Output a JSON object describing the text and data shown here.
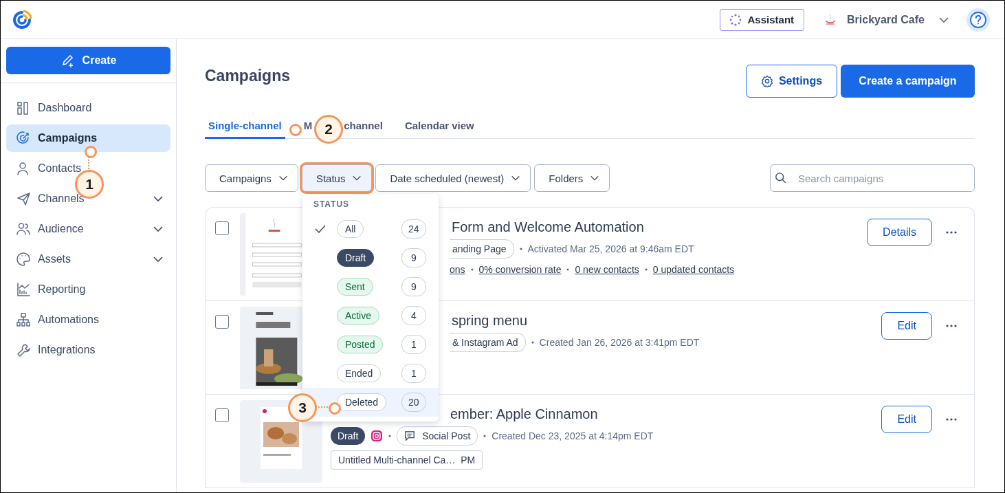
{
  "topbar": {
    "assistant": "Assistant",
    "account": "Brickyard Cafe"
  },
  "sidebar": {
    "create": "Create",
    "items": [
      {
        "label": "Dashboard",
        "selected": false,
        "expandable": false
      },
      {
        "label": "Campaigns",
        "selected": true,
        "expandable": false
      },
      {
        "label": "Contacts",
        "selected": false,
        "expandable": false
      },
      {
        "label": "Channels",
        "selected": false,
        "expandable": true
      },
      {
        "label": "Audience",
        "selected": false,
        "expandable": true
      },
      {
        "label": "Assets",
        "selected": false,
        "expandable": true
      },
      {
        "label": "Reporting",
        "selected": false,
        "expandable": false
      },
      {
        "label": "Automations",
        "selected": false,
        "expandable": false
      },
      {
        "label": "Integrations",
        "selected": false,
        "expandable": false
      }
    ]
  },
  "page": {
    "title": "Campaigns",
    "settings": "Settings",
    "create_campaign": "Create a campaign"
  },
  "tabs": [
    {
      "label": "Single-channel",
      "selected": true
    },
    {
      "label": "M",
      "label_end": "channel",
      "selected": false
    },
    {
      "label": "Calendar view",
      "selected": false
    }
  ],
  "filters": [
    {
      "label": "Campaigns",
      "open": false
    },
    {
      "label": "Status",
      "open": true
    },
    {
      "label": "Date scheduled (newest)",
      "open": false
    },
    {
      "label": "Folders",
      "open": false
    }
  ],
  "search": {
    "placeholder": "Search campaigns"
  },
  "status_menu": {
    "heading": "STATUS",
    "items": [
      {
        "label": "All",
        "count": "24",
        "kind": "neutral",
        "checked": true,
        "highlighted": false
      },
      {
        "label": "Draft",
        "count": "9",
        "kind": "dark",
        "checked": false,
        "highlighted": false
      },
      {
        "label": "Sent",
        "count": "9",
        "kind": "green",
        "checked": false,
        "highlighted": false
      },
      {
        "label": "Active",
        "count": "4",
        "kind": "green",
        "checked": false,
        "highlighted": false
      },
      {
        "label": "Posted",
        "count": "1",
        "kind": "green",
        "checked": false,
        "highlighted": false
      },
      {
        "label": "Ended",
        "count": "1",
        "kind": "neutral",
        "checked": false,
        "highlighted": false
      },
      {
        "label": "Deleted",
        "count": "20",
        "kind": "neutral",
        "checked": false,
        "highlighted": true
      }
    ]
  },
  "campaigns": [
    {
      "kind": "landing-page",
      "title": "Form and Welcome Automation",
      "chip": "anding Page",
      "meta": "Activated Mar 25, 2026 at 9:46am EDT",
      "stats": [
        "ons",
        "0% conversion rate",
        "0 new contacts",
        "0 updated contacts"
      ],
      "action": "Details",
      "checked": false
    },
    {
      "kind": "ad",
      "title": "spring menu",
      "chip": "& Instagram Ad",
      "meta": "Created Jan 26, 2026 at 3:41pm EDT",
      "action": "Edit",
      "checked": false
    },
    {
      "kind": "social-post",
      "title": "ember: Apple Cinnamon",
      "status": "Draft",
      "chip": "Social Post",
      "meta": "Created Dec 23, 2025 at 4:14pm EDT",
      "extra": "Untitled Multi-channel Ca…  PM",
      "action": "Edit",
      "checked": false
    }
  ],
  "callouts": [
    {
      "number": "1"
    },
    {
      "number": "2"
    },
    {
      "number": "3"
    }
  ]
}
